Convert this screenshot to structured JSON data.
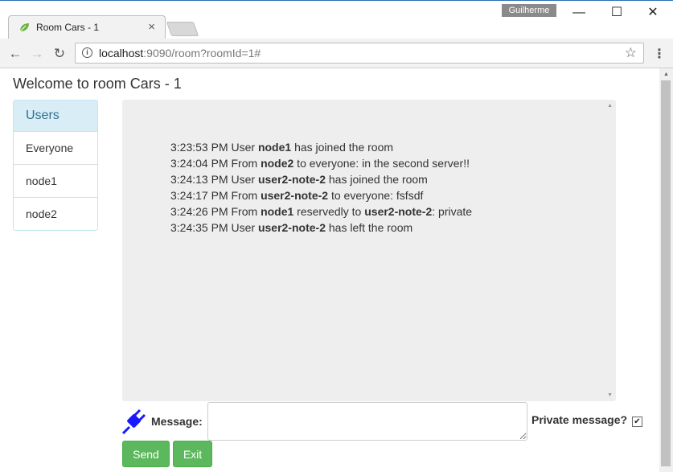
{
  "browser": {
    "tab_title": "Room Cars - 1",
    "tab_close": "×",
    "profile_name": "Guilherme",
    "minimize": "—",
    "maximize": "☐",
    "close": "✕",
    "url_host": "localhost",
    "url_rest": ":9090/room?roomId=1#"
  },
  "page": {
    "title": "Welcome to room Cars - 1"
  },
  "users": {
    "header": "Users",
    "items": [
      "Everyone",
      "node1",
      "node2"
    ]
  },
  "messages": [
    {
      "time": "3:23:53 PM",
      "parts": [
        [
          "User ",
          false
        ],
        [
          "node1",
          true
        ],
        [
          " has joined the room",
          false
        ]
      ]
    },
    {
      "time": "3:24:04 PM",
      "parts": [
        [
          "From ",
          false
        ],
        [
          "node2",
          true
        ],
        [
          " to everyone: in the second server!!",
          false
        ]
      ]
    },
    {
      "time": "3:24:13 PM",
      "parts": [
        [
          "User ",
          false
        ],
        [
          "user2-note-2",
          true
        ],
        [
          " has joined the room",
          false
        ]
      ]
    },
    {
      "time": "3:24:17 PM",
      "parts": [
        [
          "From ",
          false
        ],
        [
          "user2-note-2",
          true
        ],
        [
          " to everyone: fsfsdf",
          false
        ]
      ]
    },
    {
      "time": "3:24:26 PM",
      "parts": [
        [
          "From ",
          false
        ],
        [
          "node1",
          true
        ],
        [
          " reservedly to ",
          false
        ],
        [
          "user2-note-2",
          true
        ],
        [
          ": private",
          false
        ]
      ]
    },
    {
      "time": "3:24:35 PM",
      "parts": [
        [
          "User ",
          false
        ],
        [
          "user2-note-2",
          true
        ],
        [
          " has left the room",
          false
        ]
      ]
    }
  ],
  "composer": {
    "message_label": "Message:",
    "message_value": "",
    "private_label": "Private message?",
    "private_checked": true
  },
  "buttons": {
    "send": "Send",
    "exit": "Exit"
  },
  "colors": {
    "success": "#5cb85c",
    "panel_heading": "#d9edf7",
    "panel_heading_text": "#31708f",
    "chat_bg": "#eeeeee",
    "plug_icon": "#1a1aff"
  }
}
